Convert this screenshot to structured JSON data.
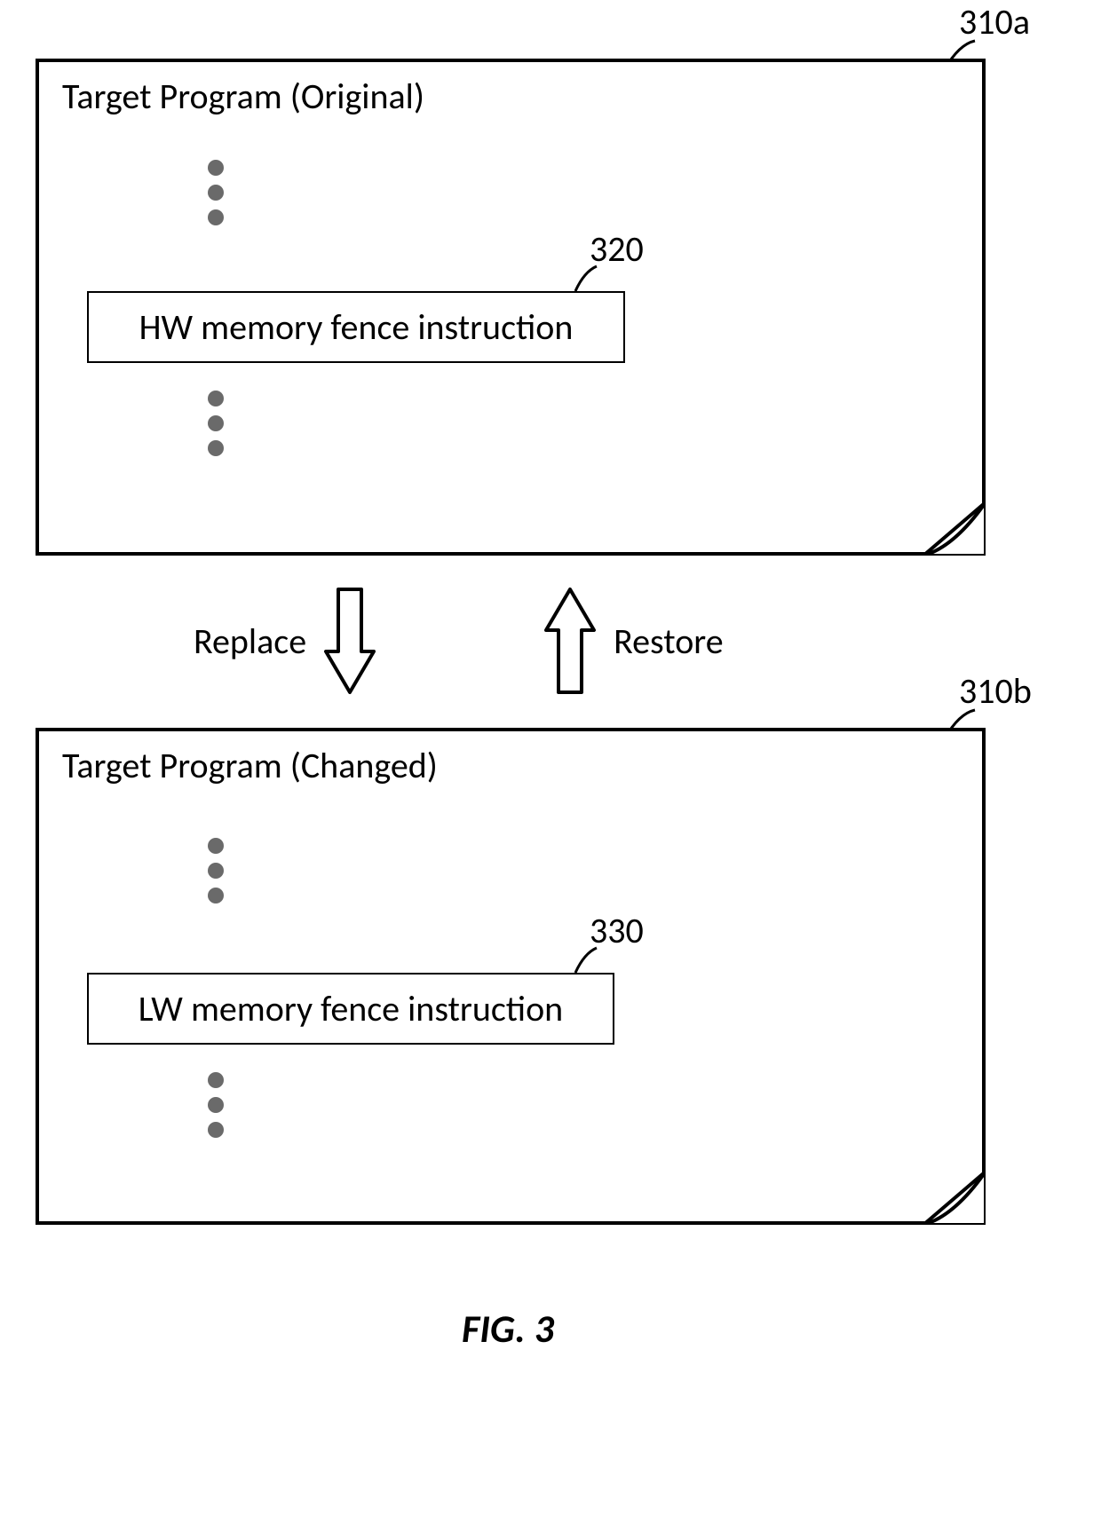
{
  "labels": {
    "ref_310a": "310a",
    "ref_310b": "310b",
    "ref_320": "320",
    "ref_330": "330",
    "original_title": "Target Program (Original)",
    "changed_title": "Target Program (Changed)",
    "hw_instruction": "HW memory fence instruction",
    "lw_instruction": "LW memory fence instruction",
    "replace": "Replace",
    "restore": "Restore",
    "figure": "FIG. 3"
  }
}
